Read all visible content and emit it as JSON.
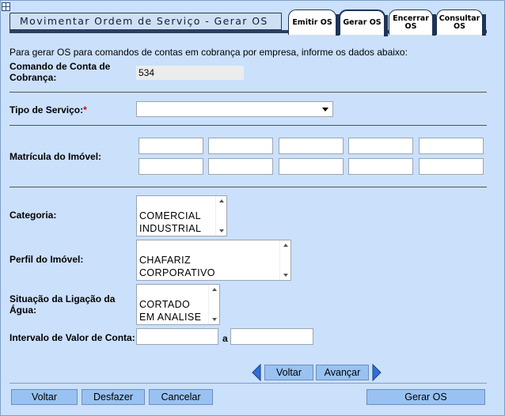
{
  "title": "Movimentar Ordem de Serviço - Gerar OS",
  "tabs": [
    {
      "label": "Emitir OS"
    },
    {
      "label": "Gerar OS",
      "active": true
    },
    {
      "label": "Encerrar OS"
    },
    {
      "label": "Consultar OS"
    }
  ],
  "intro": "Para gerar OS para comandos de contas em cobrança por empresa, informe os dados abaixo:",
  "comando": {
    "label": "Comando de Conta de Cobrança:",
    "value": "534"
  },
  "tipo_servico": {
    "label": "Tipo de Serviço:",
    "required_mark": "*",
    "value": ""
  },
  "matricula": {
    "label": "Matrícula do Imóvel:"
  },
  "categoria": {
    "label": "Categoria:",
    "options": [
      "COMERCIAL",
      "INDUSTRIAL"
    ]
  },
  "perfil": {
    "label": "Perfil do Imóvel:",
    "options": [
      "CHAFARIZ",
      "CORPORATIVO"
    ]
  },
  "situacao": {
    "label": "Situação da Ligação da Água:",
    "options": [
      "CORTADO",
      "EM ANALISE"
    ]
  },
  "intervalo": {
    "label": "Intervalo de Valor de Conta:",
    "separator": "a"
  },
  "nav": {
    "voltar": "Voltar",
    "avancar": "Avançar"
  },
  "footer": {
    "voltar": "Voltar",
    "desfazer": "Desfazer",
    "cancelar": "Cancelar",
    "gerar": "Gerar OS"
  },
  "colors": {
    "background": "#cbe0fb",
    "button": "#99c2f2",
    "nav_arrow": "#2f6fd6",
    "tab_border": "#1e3356"
  }
}
